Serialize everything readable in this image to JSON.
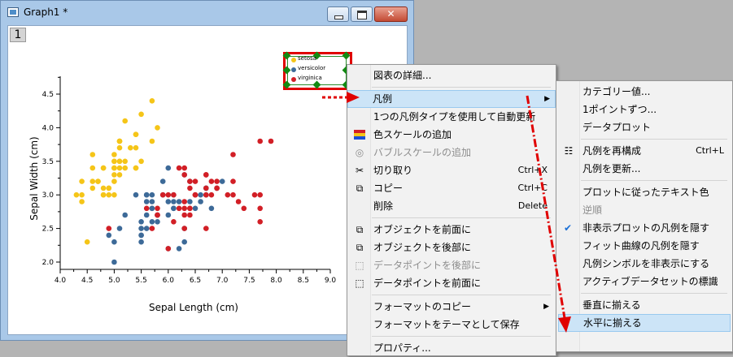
{
  "window": {
    "title": "Graph1 *",
    "layer_number": "1"
  },
  "chart_data": {
    "type": "scatter",
    "xlabel": "Sepal Length (cm)",
    "ylabel": "Sepal Width (cm)",
    "xlim": [
      4.0,
      9.0
    ],
    "ylim": [
      1.8,
      4.6
    ],
    "x_ticks": [
      "4.0",
      "4.5",
      "5.0",
      "5.5",
      "6.0",
      "6.5",
      "7.0",
      "7.5",
      "8.0",
      "8.5",
      "9.0"
    ],
    "y_ticks": [
      "2.0",
      "2.5",
      "3.0",
      "3.5",
      "4.0",
      "4.5"
    ],
    "legend_position": "top-right",
    "series": [
      {
        "name": "setosa",
        "color": "#f5c518",
        "points": [
          [
            5.1,
            3.5
          ],
          [
            4.9,
            3.0
          ],
          [
            4.7,
            3.2
          ],
          [
            4.6,
            3.1
          ],
          [
            5.0,
            3.6
          ],
          [
            5.4,
            3.9
          ],
          [
            4.6,
            3.4
          ],
          [
            5.0,
            3.4
          ],
          [
            4.4,
            2.9
          ],
          [
            4.9,
            3.1
          ],
          [
            5.4,
            3.7
          ],
          [
            4.8,
            3.4
          ],
          [
            4.8,
            3.0
          ],
          [
            4.3,
            3.0
          ],
          [
            5.8,
            4.0
          ],
          [
            5.7,
            4.4
          ],
          [
            5.4,
            3.9
          ],
          [
            5.1,
            3.5
          ],
          [
            5.7,
            3.8
          ],
          [
            5.1,
            3.8
          ],
          [
            5.4,
            3.4
          ],
          [
            5.1,
            3.7
          ],
          [
            4.6,
            3.6
          ],
          [
            5.1,
            3.3
          ],
          [
            4.8,
            3.4
          ],
          [
            5.0,
            3.0
          ],
          [
            5.0,
            3.4
          ],
          [
            5.2,
            3.5
          ],
          [
            5.2,
            3.4
          ],
          [
            4.7,
            3.2
          ],
          [
            4.8,
            3.1
          ],
          [
            5.4,
            3.4
          ],
          [
            5.2,
            4.1
          ],
          [
            5.5,
            4.2
          ],
          [
            4.9,
            3.1
          ],
          [
            5.0,
            3.2
          ],
          [
            5.5,
            3.5
          ],
          [
            4.4,
            3.0
          ],
          [
            5.1,
            3.4
          ],
          [
            5.0,
            3.5
          ],
          [
            4.5,
            2.3
          ],
          [
            4.4,
            3.2
          ],
          [
            5.0,
            3.5
          ],
          [
            5.1,
            3.8
          ],
          [
            4.8,
            3.0
          ],
          [
            5.1,
            3.8
          ],
          [
            4.6,
            3.2
          ],
          [
            5.3,
            3.7
          ],
          [
            5.0,
            3.3
          ]
        ]
      },
      {
        "name": "versicolor",
        "color": "#3d6a98",
        "points": [
          [
            7.0,
            3.2
          ],
          [
            6.4,
            3.2
          ],
          [
            6.9,
            3.1
          ],
          [
            5.5,
            2.3
          ],
          [
            6.5,
            2.8
          ],
          [
            5.7,
            2.8
          ],
          [
            6.3,
            3.3
          ],
          [
            4.9,
            2.4
          ],
          [
            6.6,
            2.9
          ],
          [
            5.2,
            2.7
          ],
          [
            5.0,
            2.0
          ],
          [
            5.9,
            3.0
          ],
          [
            6.0,
            2.2
          ],
          [
            6.1,
            2.9
          ],
          [
            5.6,
            2.9
          ],
          [
            6.7,
            3.1
          ],
          [
            5.6,
            3.0
          ],
          [
            5.8,
            2.7
          ],
          [
            6.2,
            2.2
          ],
          [
            5.6,
            2.5
          ],
          [
            5.9,
            3.2
          ],
          [
            6.1,
            2.8
          ],
          [
            6.3,
            2.5
          ],
          [
            6.1,
            2.8
          ],
          [
            6.4,
            2.9
          ],
          [
            6.6,
            3.0
          ],
          [
            6.8,
            2.8
          ],
          [
            6.7,
            3.0
          ],
          [
            6.0,
            2.9
          ],
          [
            5.7,
            2.6
          ],
          [
            5.5,
            2.4
          ],
          [
            5.5,
            2.4
          ],
          [
            5.8,
            2.7
          ],
          [
            6.0,
            2.7
          ],
          [
            5.4,
            3.0
          ],
          [
            6.0,
            3.4
          ],
          [
            6.7,
            3.1
          ],
          [
            6.3,
            2.3
          ],
          [
            5.6,
            3.0
          ],
          [
            5.5,
            2.5
          ],
          [
            5.5,
            2.6
          ],
          [
            6.1,
            3.0
          ],
          [
            5.8,
            2.6
          ],
          [
            5.0,
            2.3
          ],
          [
            5.6,
            2.7
          ],
          [
            5.7,
            3.0
          ],
          [
            5.7,
            2.9
          ],
          [
            6.2,
            2.9
          ],
          [
            5.1,
            2.5
          ],
          [
            5.7,
            2.8
          ]
        ]
      },
      {
        "name": "virginica",
        "color": "#d21f26",
        "points": [
          [
            6.3,
            3.3
          ],
          [
            5.8,
            2.7
          ],
          [
            7.1,
            3.0
          ],
          [
            6.3,
            2.9
          ],
          [
            6.5,
            3.0
          ],
          [
            7.6,
            3.0
          ],
          [
            4.9,
            2.5
          ],
          [
            7.3,
            2.9
          ],
          [
            6.7,
            2.5
          ],
          [
            7.2,
            3.6
          ],
          [
            6.5,
            3.2
          ],
          [
            6.4,
            2.7
          ],
          [
            6.8,
            3.0
          ],
          [
            5.7,
            2.5
          ],
          [
            5.8,
            2.8
          ],
          [
            6.4,
            3.2
          ],
          [
            6.5,
            3.0
          ],
          [
            7.7,
            3.8
          ],
          [
            7.7,
            2.6
          ],
          [
            6.0,
            2.2
          ],
          [
            6.9,
            3.2
          ],
          [
            5.6,
            2.8
          ],
          [
            7.7,
            2.8
          ],
          [
            6.3,
            2.7
          ],
          [
            6.7,
            3.3
          ],
          [
            7.2,
            3.2
          ],
          [
            6.2,
            2.8
          ],
          [
            6.1,
            3.0
          ],
          [
            6.4,
            2.8
          ],
          [
            7.2,
            3.0
          ],
          [
            7.4,
            2.8
          ],
          [
            7.9,
            3.8
          ],
          [
            6.4,
            2.8
          ],
          [
            6.3,
            2.8
          ],
          [
            6.1,
            2.6
          ],
          [
            7.7,
            3.0
          ],
          [
            6.3,
            3.4
          ],
          [
            6.4,
            3.1
          ],
          [
            6.0,
            3.0
          ],
          [
            6.9,
            3.1
          ],
          [
            6.7,
            3.1
          ],
          [
            6.9,
            3.1
          ],
          [
            5.8,
            2.7
          ],
          [
            6.8,
            3.2
          ],
          [
            6.7,
            3.3
          ],
          [
            6.7,
            3.0
          ],
          [
            6.3,
            2.5
          ],
          [
            6.5,
            3.0
          ],
          [
            6.2,
            3.4
          ],
          [
            5.9,
            3.0
          ]
        ]
      }
    ]
  },
  "menu1": {
    "items": [
      {
        "label": "図表の詳細...",
        "shortcut": "",
        "icon": "",
        "disabled": false,
        "submenu": false,
        "sepAfter": true
      },
      {
        "label": "凡例",
        "shortcut": "",
        "icon": "",
        "disabled": false,
        "submenu": true,
        "highlighted": true,
        "sepAfter": false
      },
      {
        "label": "1つの凡例タイプを使用して自動更新",
        "shortcut": "",
        "icon": "",
        "disabled": false,
        "submenu": false,
        "sepAfter": false
      },
      {
        "label": "色スケールの追加",
        "shortcut": "",
        "icon": "color-scale-icon",
        "disabled": false,
        "submenu": false,
        "sepAfter": false
      },
      {
        "label": "バブルスケールの追加",
        "shortcut": "",
        "icon": "bubble-scale-icon",
        "disabled": true,
        "submenu": false,
        "sepAfter": false
      },
      {
        "label": "切り取り",
        "shortcut": "Ctrl+X",
        "icon": "scissors-icon",
        "disabled": false,
        "submenu": false,
        "sepAfter": false
      },
      {
        "label": "コピー",
        "shortcut": "Ctrl+C",
        "icon": "copy-icon",
        "disabled": false,
        "submenu": false,
        "sepAfter": false
      },
      {
        "label": "削除",
        "shortcut": "Delete",
        "icon": "",
        "disabled": false,
        "submenu": false,
        "sepAfter": true
      },
      {
        "label": "オブジェクトを前面に",
        "shortcut": "",
        "icon": "bring-front-icon",
        "disabled": false,
        "submenu": false,
        "sepAfter": false
      },
      {
        "label": "オブジェクトを後部に",
        "shortcut": "",
        "icon": "send-back-icon",
        "disabled": false,
        "submenu": false,
        "sepAfter": false
      },
      {
        "label": "データポイントを後部に",
        "shortcut": "",
        "icon": "points-back-icon",
        "disabled": true,
        "submenu": false,
        "sepAfter": false
      },
      {
        "label": "データポイントを前面に",
        "shortcut": "",
        "icon": "points-front-icon",
        "disabled": false,
        "submenu": false,
        "sepAfter": true
      },
      {
        "label": "フォーマットのコピー",
        "shortcut": "",
        "icon": "",
        "disabled": false,
        "submenu": true,
        "sepAfter": false
      },
      {
        "label": "フォーマットをテーマとして保存",
        "shortcut": "",
        "icon": "",
        "disabled": false,
        "submenu": false,
        "sepAfter": true
      },
      {
        "label": "プロパティ...",
        "shortcut": "",
        "icon": "",
        "disabled": false,
        "submenu": false,
        "sepAfter": false
      }
    ]
  },
  "menu2": {
    "items": [
      {
        "label": "カテゴリー値...",
        "shortcut": "",
        "icon": "",
        "disabled": false,
        "checked": false
      },
      {
        "label": "1ポイントずつ...",
        "shortcut": "",
        "icon": "",
        "disabled": false,
        "checked": false
      },
      {
        "label": "データプロット",
        "shortcut": "",
        "icon": "",
        "disabled": false,
        "checked": false,
        "sepAfter": true
      },
      {
        "label": "凡例を再構成",
        "shortcut": "Ctrl+L",
        "icon": "reconstruct-icon",
        "disabled": false,
        "checked": false
      },
      {
        "label": "凡例を更新...",
        "shortcut": "",
        "icon": "",
        "disabled": false,
        "checked": false,
        "sepAfter": true
      },
      {
        "label": "プロットに従ったテキスト色",
        "shortcut": "",
        "icon": "",
        "disabled": false,
        "checked": false
      },
      {
        "label": "逆順",
        "shortcut": "",
        "icon": "",
        "disabled": true,
        "checked": false
      },
      {
        "label": "非表示プロットの凡例を隠す",
        "shortcut": "",
        "icon": "",
        "disabled": false,
        "checked": true
      },
      {
        "label": "フィット曲線の凡例を隠す",
        "shortcut": "",
        "icon": "",
        "disabled": false,
        "checked": false
      },
      {
        "label": "凡例シンボルを非表示にする",
        "shortcut": "",
        "icon": "",
        "disabled": false,
        "checked": false
      },
      {
        "label": "アクティブデータセットの標識",
        "shortcut": "",
        "icon": "",
        "disabled": false,
        "checked": false,
        "sepAfter": true
      },
      {
        "label": "垂直に揃える",
        "shortcut": "",
        "icon": "",
        "disabled": false,
        "checked": false
      },
      {
        "label": "水平に揃える",
        "shortcut": "",
        "icon": "",
        "disabled": false,
        "checked": false,
        "highlighted": true
      }
    ]
  }
}
